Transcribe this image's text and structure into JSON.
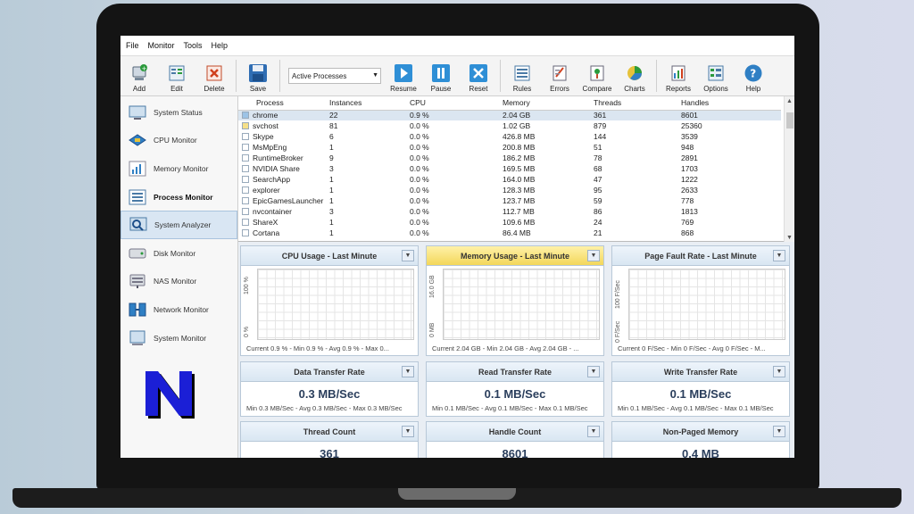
{
  "menu": [
    "File",
    "Monitor",
    "Tools",
    "Help"
  ],
  "toolbar": {
    "add": "Add",
    "edit": "Edit",
    "delete": "Delete",
    "save": "Save",
    "combo_value": "Active Processes",
    "resume": "Resume",
    "pause": "Pause",
    "reset": "Reset",
    "rules": "Rules",
    "errors": "Errors",
    "compare": "Compare",
    "charts": "Charts",
    "reports": "Reports",
    "options": "Options",
    "help": "Help"
  },
  "sidebar": {
    "items": [
      {
        "label": "System Status"
      },
      {
        "label": "CPU Monitor"
      },
      {
        "label": "Memory Monitor"
      },
      {
        "label": "Process Monitor"
      },
      {
        "label": "System Analyzer"
      },
      {
        "label": "Disk Monitor"
      },
      {
        "label": "NAS Monitor"
      },
      {
        "label": "Network Monitor"
      },
      {
        "label": "System Monitor"
      }
    ],
    "logo_letter": "N"
  },
  "table": {
    "headers": [
      "Process",
      "Instances",
      "CPU",
      "Memory",
      "Threads",
      "Handles"
    ],
    "rows": [
      [
        "chrome",
        "22",
        "0.9 %",
        "2.04 GB",
        "361",
        "8601"
      ],
      [
        "svchost",
        "81",
        "0.0 %",
        "1.02 GB",
        "879",
        "25360"
      ],
      [
        "Skype",
        "6",
        "0.0 %",
        "426.8 MB",
        "144",
        "3539"
      ],
      [
        "MsMpEng",
        "1",
        "0.0 %",
        "200.8 MB",
        "51",
        "948"
      ],
      [
        "RuntimeBroker",
        "9",
        "0.0 %",
        "186.2 MB",
        "78",
        "2891"
      ],
      [
        "NVIDIA Share",
        "3",
        "0.0 %",
        "169.5 MB",
        "68",
        "1703"
      ],
      [
        "SearchApp",
        "1",
        "0.0 %",
        "164.0 MB",
        "47",
        "1222"
      ],
      [
        "explorer",
        "1",
        "0.0 %",
        "128.3 MB",
        "95",
        "2633"
      ],
      [
        "EpicGamesLauncher",
        "1",
        "0.0 %",
        "123.7 MB",
        "59",
        "778"
      ],
      [
        "nvcontainer",
        "3",
        "0.0 %",
        "112.7 MB",
        "86",
        "1813"
      ],
      [
        "ShareX",
        "1",
        "0.0 %",
        "109.6 MB",
        "24",
        "769"
      ],
      [
        "Cortana",
        "1",
        "0.0 %",
        "86.4 MB",
        "21",
        "868"
      ]
    ]
  },
  "charts": {
    "cpu": {
      "title": "CPU Usage - Last Minute",
      "ymax": "100 %",
      "ymin": "0 %",
      "footer": "Current 0.9 % - Min 0.9 % - Avg 0.9 % - Max 0..."
    },
    "memory": {
      "title": "Memory Usage - Last Minute",
      "ymax": "16.0 GB",
      "ymin": "0 MB",
      "footer": "Current 2.04 GB - Min 2.04 GB - Avg 2.04 GB - ..."
    },
    "pagefault": {
      "title": "Page Fault Rate - Last Minute",
      "ymax": "100 F/Sec",
      "ymin": "0 F/Sec",
      "footer": "Current 0 F/Sec - Min 0 F/Sec - Avg 0 F/Sec - M..."
    }
  },
  "stats": {
    "data_transfer": {
      "title": "Data Transfer Rate",
      "value": "0.3 MB/Sec",
      "footer": "Min 0.3 MB/Sec - Avg 0.3 MB/Sec - Max 0.3 MB/Sec"
    },
    "read_transfer": {
      "title": "Read Transfer Rate",
      "value": "0.1 MB/Sec",
      "footer": "Min 0.1 MB/Sec - Avg 0.1 MB/Sec - Max 0.1 MB/Sec"
    },
    "write_transfer": {
      "title": "Write Transfer Rate",
      "value": "0.1 MB/Sec",
      "footer": "Min 0.1 MB/Sec - Avg 0.1 MB/Sec - Max 0.1 MB/Sec"
    },
    "thread_count": {
      "title": "Thread Count",
      "value": "361"
    },
    "handle_count": {
      "title": "Handle Count",
      "value": "8601"
    },
    "nonpaged": {
      "title": "Non-Paged Memory",
      "value": "0.4 MB"
    }
  },
  "colors": {
    "accent_blue": "#2f7fc4",
    "selection": "#dbe6f1",
    "yellow_header": "#f3d75a",
    "logo_blue": "#1b1fd6"
  }
}
